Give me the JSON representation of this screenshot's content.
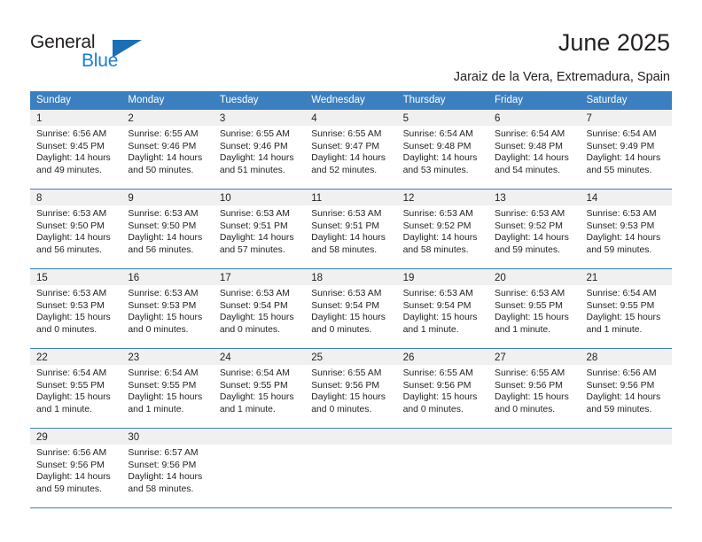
{
  "brand": {
    "name_primary": "General",
    "name_secondary": "Blue",
    "primary_color": "#231f20",
    "secondary_color": "#1a7fd4",
    "triangle_color": "#1a6fb5"
  },
  "header": {
    "title": "June 2025",
    "subtitle": "Jaraiz de la Vera, Extremadura, Spain"
  },
  "calendar": {
    "header_bg": "#3c7fc1",
    "header_text_color": "#ffffff",
    "day_band_bg": "#f0f0f0",
    "weekday_headers": [
      "Sunday",
      "Monday",
      "Tuesday",
      "Wednesday",
      "Thursday",
      "Friday",
      "Saturday"
    ],
    "weeks": [
      [
        {
          "day": "1",
          "sunrise": "Sunrise: 6:56 AM",
          "sunset": "Sunset: 9:45 PM",
          "daylight_line1": "Daylight: 14 hours",
          "daylight_line2": "and 49 minutes."
        },
        {
          "day": "2",
          "sunrise": "Sunrise: 6:55 AM",
          "sunset": "Sunset: 9:46 PM",
          "daylight_line1": "Daylight: 14 hours",
          "daylight_line2": "and 50 minutes."
        },
        {
          "day": "3",
          "sunrise": "Sunrise: 6:55 AM",
          "sunset": "Sunset: 9:46 PM",
          "daylight_line1": "Daylight: 14 hours",
          "daylight_line2": "and 51 minutes."
        },
        {
          "day": "4",
          "sunrise": "Sunrise: 6:55 AM",
          "sunset": "Sunset: 9:47 PM",
          "daylight_line1": "Daylight: 14 hours",
          "daylight_line2": "and 52 minutes."
        },
        {
          "day": "5",
          "sunrise": "Sunrise: 6:54 AM",
          "sunset": "Sunset: 9:48 PM",
          "daylight_line1": "Daylight: 14 hours",
          "daylight_line2": "and 53 minutes."
        },
        {
          "day": "6",
          "sunrise": "Sunrise: 6:54 AM",
          "sunset": "Sunset: 9:48 PM",
          "daylight_line1": "Daylight: 14 hours",
          "daylight_line2": "and 54 minutes."
        },
        {
          "day": "7",
          "sunrise": "Sunrise: 6:54 AM",
          "sunset": "Sunset: 9:49 PM",
          "daylight_line1": "Daylight: 14 hours",
          "daylight_line2": "and 55 minutes."
        }
      ],
      [
        {
          "day": "8",
          "sunrise": "Sunrise: 6:53 AM",
          "sunset": "Sunset: 9:50 PM",
          "daylight_line1": "Daylight: 14 hours",
          "daylight_line2": "and 56 minutes."
        },
        {
          "day": "9",
          "sunrise": "Sunrise: 6:53 AM",
          "sunset": "Sunset: 9:50 PM",
          "daylight_line1": "Daylight: 14 hours",
          "daylight_line2": "and 56 minutes."
        },
        {
          "day": "10",
          "sunrise": "Sunrise: 6:53 AM",
          "sunset": "Sunset: 9:51 PM",
          "daylight_line1": "Daylight: 14 hours",
          "daylight_line2": "and 57 minutes."
        },
        {
          "day": "11",
          "sunrise": "Sunrise: 6:53 AM",
          "sunset": "Sunset: 9:51 PM",
          "daylight_line1": "Daylight: 14 hours",
          "daylight_line2": "and 58 minutes."
        },
        {
          "day": "12",
          "sunrise": "Sunrise: 6:53 AM",
          "sunset": "Sunset: 9:52 PM",
          "daylight_line1": "Daylight: 14 hours",
          "daylight_line2": "and 58 minutes."
        },
        {
          "day": "13",
          "sunrise": "Sunrise: 6:53 AM",
          "sunset": "Sunset: 9:52 PM",
          "daylight_line1": "Daylight: 14 hours",
          "daylight_line2": "and 59 minutes."
        },
        {
          "day": "14",
          "sunrise": "Sunrise: 6:53 AM",
          "sunset": "Sunset: 9:53 PM",
          "daylight_line1": "Daylight: 14 hours",
          "daylight_line2": "and 59 minutes."
        }
      ],
      [
        {
          "day": "15",
          "sunrise": "Sunrise: 6:53 AM",
          "sunset": "Sunset: 9:53 PM",
          "daylight_line1": "Daylight: 15 hours",
          "daylight_line2": "and 0 minutes."
        },
        {
          "day": "16",
          "sunrise": "Sunrise: 6:53 AM",
          "sunset": "Sunset: 9:53 PM",
          "daylight_line1": "Daylight: 15 hours",
          "daylight_line2": "and 0 minutes."
        },
        {
          "day": "17",
          "sunrise": "Sunrise: 6:53 AM",
          "sunset": "Sunset: 9:54 PM",
          "daylight_line1": "Daylight: 15 hours",
          "daylight_line2": "and 0 minutes."
        },
        {
          "day": "18",
          "sunrise": "Sunrise: 6:53 AM",
          "sunset": "Sunset: 9:54 PM",
          "daylight_line1": "Daylight: 15 hours",
          "daylight_line2": "and 0 minutes."
        },
        {
          "day": "19",
          "sunrise": "Sunrise: 6:53 AM",
          "sunset": "Sunset: 9:54 PM",
          "daylight_line1": "Daylight: 15 hours",
          "daylight_line2": "and 1 minute."
        },
        {
          "day": "20",
          "sunrise": "Sunrise: 6:53 AM",
          "sunset": "Sunset: 9:55 PM",
          "daylight_line1": "Daylight: 15 hours",
          "daylight_line2": "and 1 minute."
        },
        {
          "day": "21",
          "sunrise": "Sunrise: 6:54 AM",
          "sunset": "Sunset: 9:55 PM",
          "daylight_line1": "Daylight: 15 hours",
          "daylight_line2": "and 1 minute."
        }
      ],
      [
        {
          "day": "22",
          "sunrise": "Sunrise: 6:54 AM",
          "sunset": "Sunset: 9:55 PM",
          "daylight_line1": "Daylight: 15 hours",
          "daylight_line2": "and 1 minute."
        },
        {
          "day": "23",
          "sunrise": "Sunrise: 6:54 AM",
          "sunset": "Sunset: 9:55 PM",
          "daylight_line1": "Daylight: 15 hours",
          "daylight_line2": "and 1 minute."
        },
        {
          "day": "24",
          "sunrise": "Sunrise: 6:54 AM",
          "sunset": "Sunset: 9:55 PM",
          "daylight_line1": "Daylight: 15 hours",
          "daylight_line2": "and 1 minute."
        },
        {
          "day": "25",
          "sunrise": "Sunrise: 6:55 AM",
          "sunset": "Sunset: 9:56 PM",
          "daylight_line1": "Daylight: 15 hours",
          "daylight_line2": "and 0 minutes."
        },
        {
          "day": "26",
          "sunrise": "Sunrise: 6:55 AM",
          "sunset": "Sunset: 9:56 PM",
          "daylight_line1": "Daylight: 15 hours",
          "daylight_line2": "and 0 minutes."
        },
        {
          "day": "27",
          "sunrise": "Sunrise: 6:55 AM",
          "sunset": "Sunset: 9:56 PM",
          "daylight_line1": "Daylight: 15 hours",
          "daylight_line2": "and 0 minutes."
        },
        {
          "day": "28",
          "sunrise": "Sunrise: 6:56 AM",
          "sunset": "Sunset: 9:56 PM",
          "daylight_line1": "Daylight: 14 hours",
          "daylight_line2": "and 59 minutes."
        }
      ],
      [
        {
          "day": "29",
          "sunrise": "Sunrise: 6:56 AM",
          "sunset": "Sunset: 9:56 PM",
          "daylight_line1": "Daylight: 14 hours",
          "daylight_line2": "and 59 minutes."
        },
        {
          "day": "30",
          "sunrise": "Sunrise: 6:57 AM",
          "sunset": "Sunset: 9:56 PM",
          "daylight_line1": "Daylight: 14 hours",
          "daylight_line2": "and 58 minutes."
        },
        {
          "day": "",
          "sunrise": "",
          "sunset": "",
          "daylight_line1": "",
          "daylight_line2": ""
        },
        {
          "day": "",
          "sunrise": "",
          "sunset": "",
          "daylight_line1": "",
          "daylight_line2": ""
        },
        {
          "day": "",
          "sunrise": "",
          "sunset": "",
          "daylight_line1": "",
          "daylight_line2": ""
        },
        {
          "day": "",
          "sunrise": "",
          "sunset": "",
          "daylight_line1": "",
          "daylight_line2": ""
        },
        {
          "day": "",
          "sunrise": "",
          "sunset": "",
          "daylight_line1": "",
          "daylight_line2": ""
        }
      ]
    ]
  }
}
